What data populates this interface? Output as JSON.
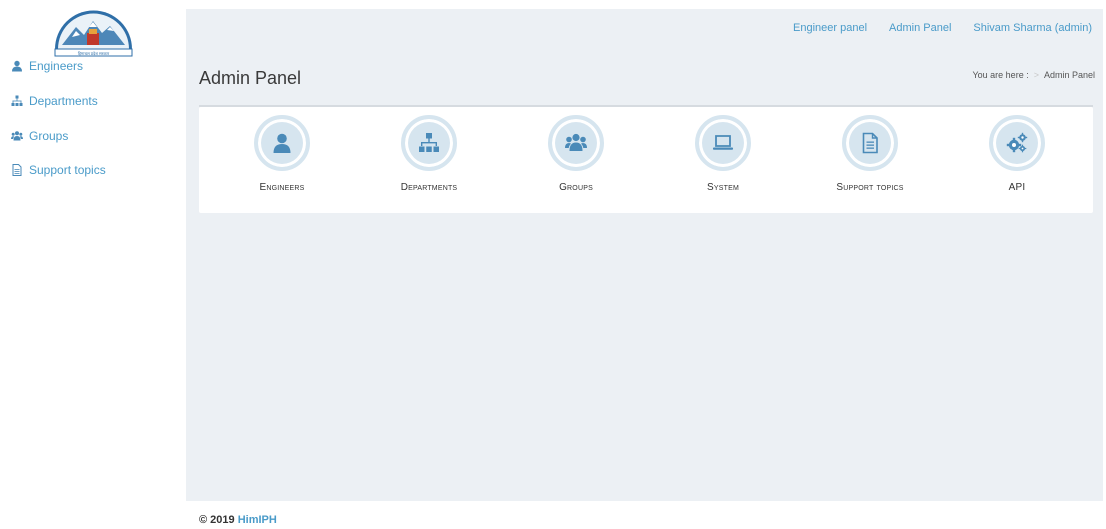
{
  "sidebar": {
    "logo_text": "हिमाचल प्रदेश सरकार",
    "items": [
      {
        "label": "Engineers",
        "icon": "user-icon"
      },
      {
        "label": "Departments",
        "icon": "sitemap-icon"
      },
      {
        "label": "Groups",
        "icon": "group-icon"
      },
      {
        "label": "Support topics",
        "icon": "document-icon"
      }
    ]
  },
  "topnav": {
    "engineer_panel": "Engineer panel",
    "admin_panel": "Admin Panel",
    "user": "Shivam Sharma (admin)"
  },
  "page": {
    "title": "Admin Panel",
    "breadcrumb_prefix": "You are here :",
    "breadcrumb_current": "Admin Panel"
  },
  "tiles": [
    {
      "label": "Engineers",
      "icon": "user-icon"
    },
    {
      "label": "Departments",
      "icon": "sitemap-icon"
    },
    {
      "label": "Groups",
      "icon": "group-icon"
    },
    {
      "label": "System",
      "icon": "laptop-icon"
    },
    {
      "label": "Support topics",
      "icon": "document-icon"
    },
    {
      "label": "API",
      "icon": "cogs-icon"
    }
  ],
  "footer": {
    "copyright": "© 2019",
    "brand": "HimIPH"
  },
  "colors": {
    "accent": "#4a9bc9",
    "icon": "#4a8ab8",
    "panel_bg": "#ecf0f4"
  }
}
